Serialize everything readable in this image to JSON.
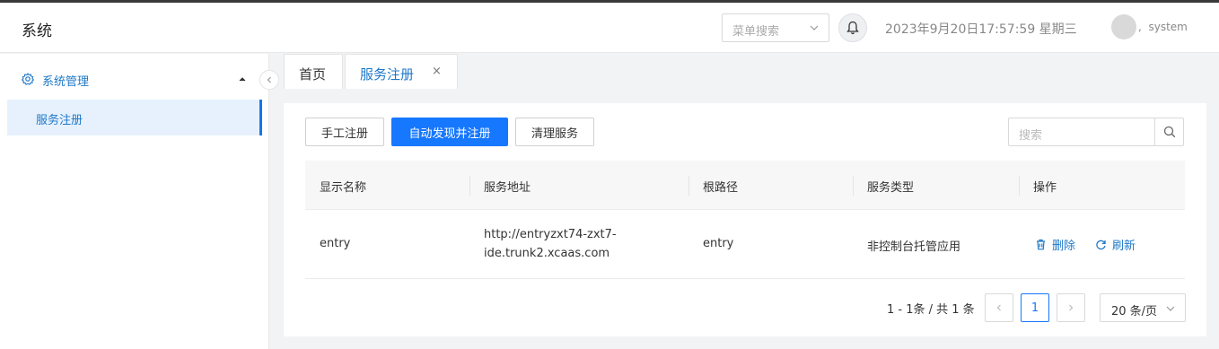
{
  "header": {
    "app_title": "系统",
    "menu_search_placeholder": "菜单搜索",
    "datetime": "2023年9月20日17:57:59 星期三",
    "user_name": "system",
    "user_prefix": ","
  },
  "sidebar": {
    "group_label": "系统管理",
    "items": [
      {
        "label": "服务注册"
      }
    ]
  },
  "tabs": [
    {
      "label": "首页"
    },
    {
      "label": "服务注册",
      "close": "×"
    }
  ],
  "toolbar": {
    "manual_label": "手工注册",
    "auto_label": "自动发现并注册",
    "clean_label": "清理服务",
    "search_placeholder": "搜索"
  },
  "table": {
    "columns": [
      "显示名称",
      "服务地址",
      "根路径",
      "服务类型",
      "操作"
    ],
    "rows": [
      {
        "name": "entry",
        "address_line1": "http://entryzxt74-zxt7-",
        "address_line2": "ide.trunk2.xcaas.com",
        "root_path": "entry",
        "service_type": "非控制台托管应用",
        "delete_label": "删除",
        "refresh_label": "刷新"
      }
    ]
  },
  "pagination": {
    "info": "1 - 1条 / 共 1 条",
    "current_page": "1",
    "page_size": "20 条/页"
  },
  "colors": {
    "primary": "#1677ff",
    "link": "#1e78c8",
    "active_bg": "#e6f1fd"
  }
}
